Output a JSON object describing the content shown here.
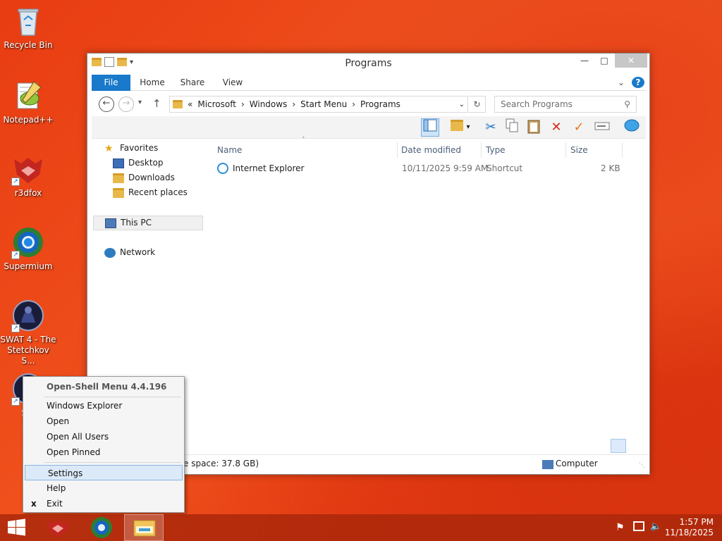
{
  "desktop": {
    "icons": [
      {
        "label": "Recycle Bin",
        "icon": "recycle-bin-icon"
      },
      {
        "label": "Notepad++",
        "icon": "notepad-plus-plus-icon"
      },
      {
        "label": "r3dfox",
        "icon": "r3dfox-icon"
      },
      {
        "label": "Supermium",
        "icon": "supermium-icon"
      },
      {
        "label": "SWAT 4 - The Stetchkov S...",
        "icon": "swat4-icon"
      },
      {
        "label": "SW",
        "icon": "swat4-icon"
      }
    ]
  },
  "window": {
    "title": "Programs",
    "ribbon_tabs": [
      "File",
      "Home",
      "Share",
      "View"
    ],
    "address": {
      "prefix": "«",
      "segments": [
        "Microsoft",
        "Windows",
        "Start Menu",
        "Programs"
      ]
    },
    "search_placeholder": "Search Programs",
    "nav": {
      "favorites": "Favorites",
      "desktop": "Desktop",
      "downloads": "Downloads",
      "recent": "Recent places",
      "this_pc": "This PC",
      "network": "Network"
    },
    "columns": {
      "name": "Name",
      "date": "Date modified",
      "type": "Type",
      "size": "Size"
    },
    "files": [
      {
        "name": "Internet Explorer",
        "date": "10/11/2025 9:59 AM",
        "type": "Shortcut",
        "size": "2 KB"
      }
    ],
    "status": {
      "free_space": "e space: 37.8 GB)",
      "location": "Computer"
    }
  },
  "context_menu": {
    "header": "Open-Shell Menu 4.4.196",
    "items": [
      "Windows Explorer",
      "Open",
      "Open All Users",
      "Open Pinned"
    ],
    "items2": [
      "Settings",
      "Help",
      "Exit"
    ],
    "exit_mark": "x"
  },
  "taskbar": {
    "time": "1:57 PM",
    "date": "11/18/2025"
  },
  "colors": {
    "accent": "#1979ca",
    "desktop": "#e8431a",
    "highlight": "#dbe9f8"
  }
}
